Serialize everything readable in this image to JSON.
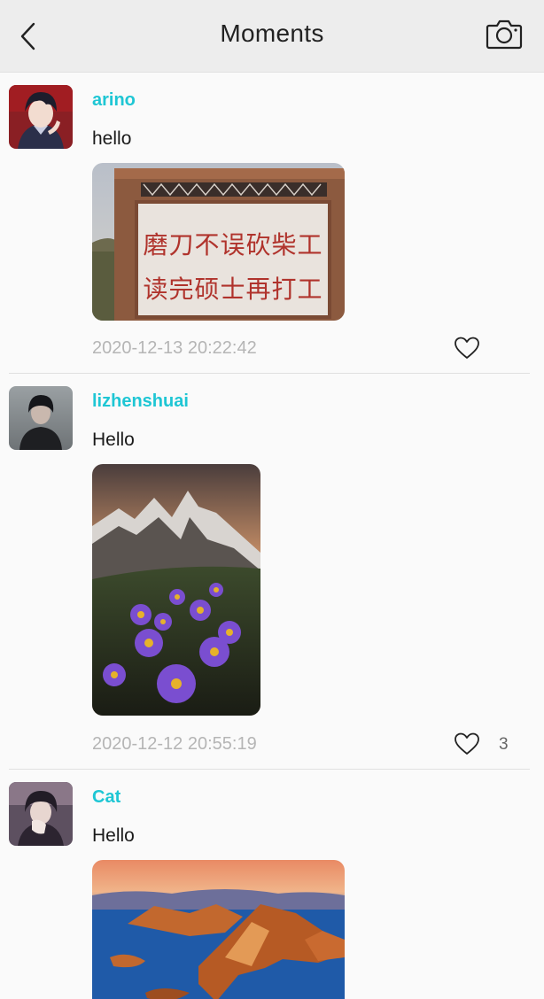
{
  "header": {
    "title": "Moments",
    "back_icon": "chevron-left-icon",
    "camera_icon": "camera-icon"
  },
  "colors": {
    "username": "#1ec6d4",
    "timestamp": "#b5b5b5",
    "header_bg": "#ededed"
  },
  "posts": [
    {
      "username": "arino",
      "text": "hello",
      "sign_line1": "磨刀不误砍柴工",
      "sign_line2": "读完硕士再打工",
      "timestamp": "2020-12-13 20:22:42",
      "likes": ""
    },
    {
      "username": "lizhenshuai",
      "text": "Hello",
      "timestamp": "2020-12-12 20:55:19",
      "likes": "3"
    },
    {
      "username": "Cat",
      "text": "Hello",
      "timestamp": "",
      "likes": ""
    }
  ]
}
